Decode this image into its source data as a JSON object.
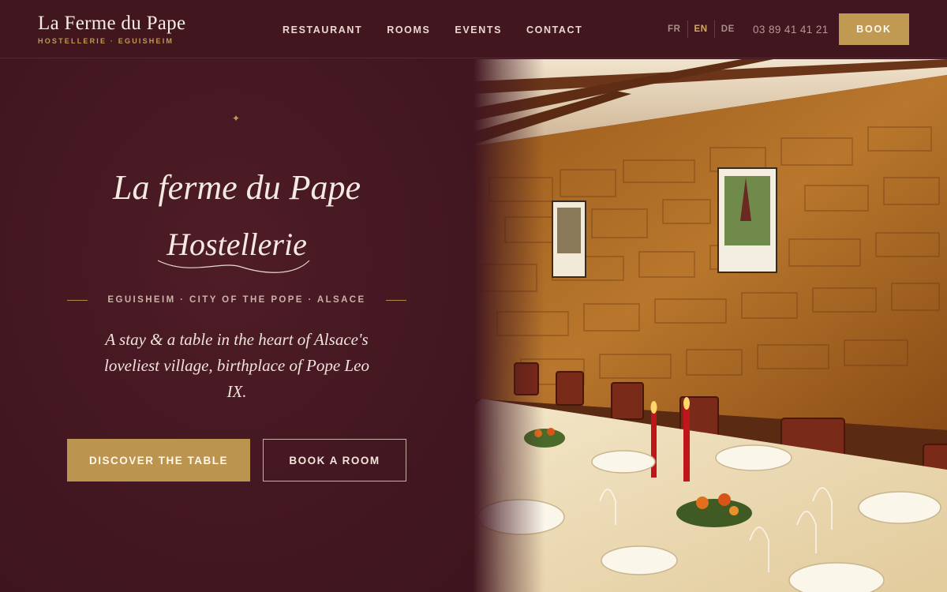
{
  "header": {
    "brand_name": "La Ferme du Pape",
    "brand_sub": "HOSTELLERIE · EGUISHEIM",
    "nav": [
      "RESTAURANT",
      "ROOMS",
      "EVENTS",
      "CONTACT"
    ],
    "languages": [
      "FR",
      "EN",
      "DE"
    ],
    "active_language": "EN",
    "phone": "03 89 41 41 21",
    "book_label": "BOOK"
  },
  "hero": {
    "script_line1": "La ferme du Pape",
    "script_line2": "Hostellerie",
    "tagline": "EGUISHEIM · CITY OF THE POPE · ALSACE",
    "intro": "A stay & a table in the heart of Alsace's loveliest village, birthplace of Pope Leo IX.",
    "cta_primary": "DISCOVER THE TABLE",
    "cta_secondary": "BOOK A ROOM"
  },
  "colors": {
    "background": "#41161f",
    "accent_gold": "#c19a52",
    "text_light": "#f3e6dc"
  },
  "icons": {
    "sparkle": "sparkle-icon"
  }
}
